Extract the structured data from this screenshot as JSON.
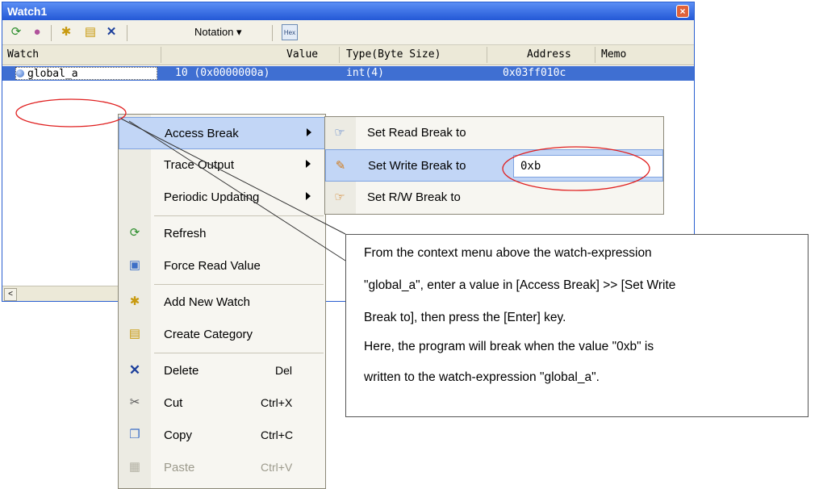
{
  "window": {
    "title": "Watch1",
    "close_glyph": "×"
  },
  "toolbar": {
    "icons": [
      "refresh-icon",
      "palette-icon",
      "add-watch-icon",
      "create-category-icon",
      "delete-icon"
    ],
    "delete_glyph": "✕",
    "notation_label": "Notation ▾",
    "hex_label": "Hex"
  },
  "grid": {
    "columns": [
      "Watch",
      "Value",
      "Type(Byte Size)",
      "Address",
      "Memo"
    ],
    "selected_row": {
      "name": "global_a",
      "value": "10 (0x0000000a)",
      "type": "int(4)",
      "address": "0x03ff010c"
    },
    "scroll_glyph": "<"
  },
  "context_menu": {
    "items": [
      {
        "label": "Access Break",
        "submenu": true
      },
      {
        "label": "Trace Output",
        "submenu": true
      },
      {
        "label": "Periodic Updating",
        "submenu": true
      },
      {
        "label": "Refresh",
        "icon": "refresh-icon"
      },
      {
        "label": "Force Read Value",
        "icon": "force-read-icon"
      },
      {
        "label": "Add New Watch",
        "icon": "add-watch-icon"
      },
      {
        "label": "Create Category",
        "icon": "create-category-icon"
      },
      {
        "label": "Delete",
        "shortcut": "Del",
        "icon": "delete-icon"
      },
      {
        "label": "Cut",
        "shortcut": "Ctrl+X",
        "icon": "cut-icon"
      },
      {
        "label": "Copy",
        "shortcut": "Ctrl+C",
        "icon": "copy-icon"
      },
      {
        "label": "Paste",
        "shortcut": "Ctrl+V",
        "icon": "paste-icon",
        "disabled": true
      }
    ]
  },
  "submenu": {
    "items": [
      {
        "label": "Set Read Break to"
      },
      {
        "label": "Set Write Break to",
        "value": "0xb"
      },
      {
        "label": "Set R/W Break to"
      }
    ]
  },
  "callout": {
    "lines": [
      "From the context menu above the watch-expression",
      "\"global_a\", enter a value in [Access Break] >> [Set Write",
      "Break to], then press the [Enter] key.",
      "Here, the program will break when the value \"0xb\" is",
      "written to the watch-expression \"global_a\"."
    ]
  },
  "colors": {
    "title_bar": "#2358d6",
    "selection": "#3f6fd2",
    "highlight": "#c2d6f6",
    "annotation": "#e02020"
  }
}
